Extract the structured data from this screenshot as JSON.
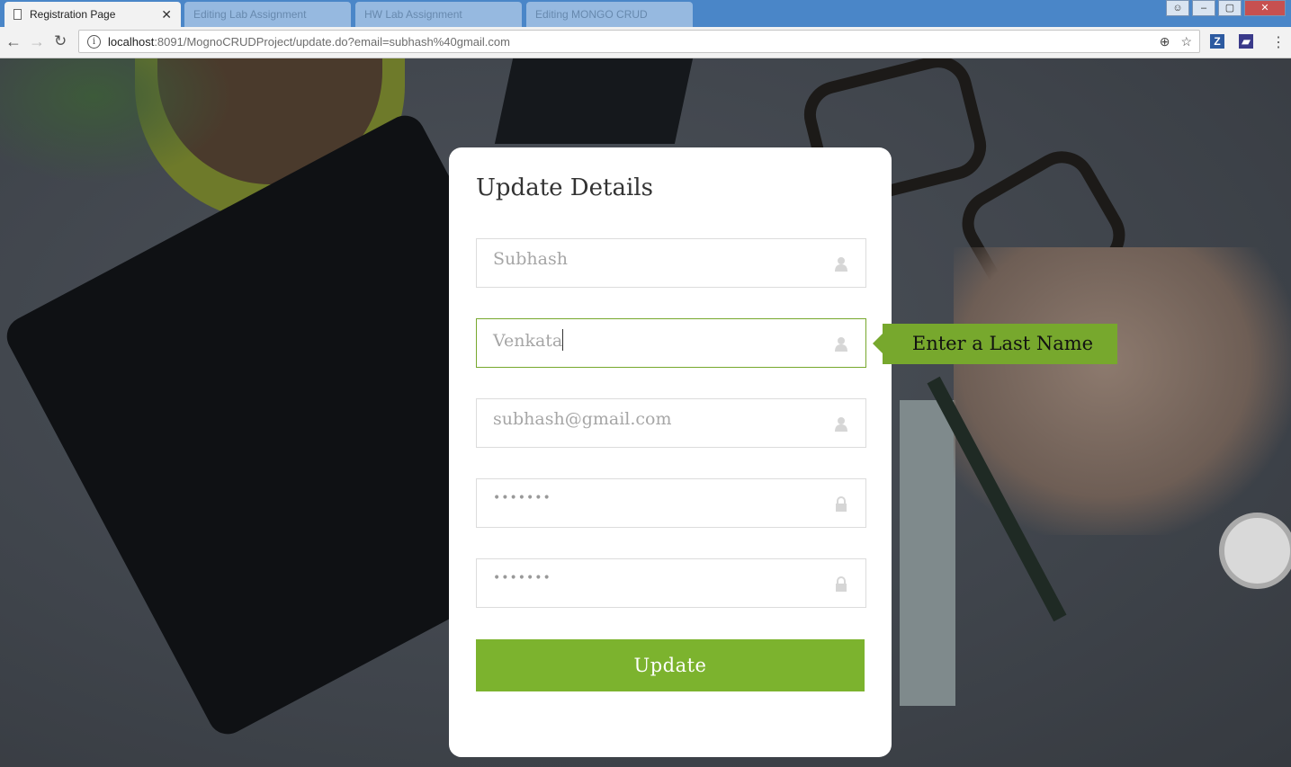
{
  "browser": {
    "tabs": [
      {
        "title": "Registration Page",
        "active": true
      },
      {
        "title": "Editing Lab Assignment",
        "active": false
      },
      {
        "title": "HW Lab Assignment",
        "active": false
      },
      {
        "title": "Editing MONGO CRUD",
        "active": false
      }
    ],
    "url_host": "localhost",
    "url_path": ":8091/MognoCRUDProject/update.do?email=subhash%40gmail.com",
    "window_buttons": {
      "minimize": "–",
      "maximize": "▢",
      "close": "✕"
    }
  },
  "form": {
    "title": "Update Details",
    "first_name": "Subhash",
    "last_name": "Venkata",
    "email": "subhash@gmail.com",
    "password": "•••••••",
    "confirm_password": "•••••••",
    "submit_label": "Update"
  },
  "tooltip": {
    "text": "Enter a Last Name"
  },
  "colors": {
    "accent": "#7cb32e",
    "tooltip": "#77a82d"
  }
}
